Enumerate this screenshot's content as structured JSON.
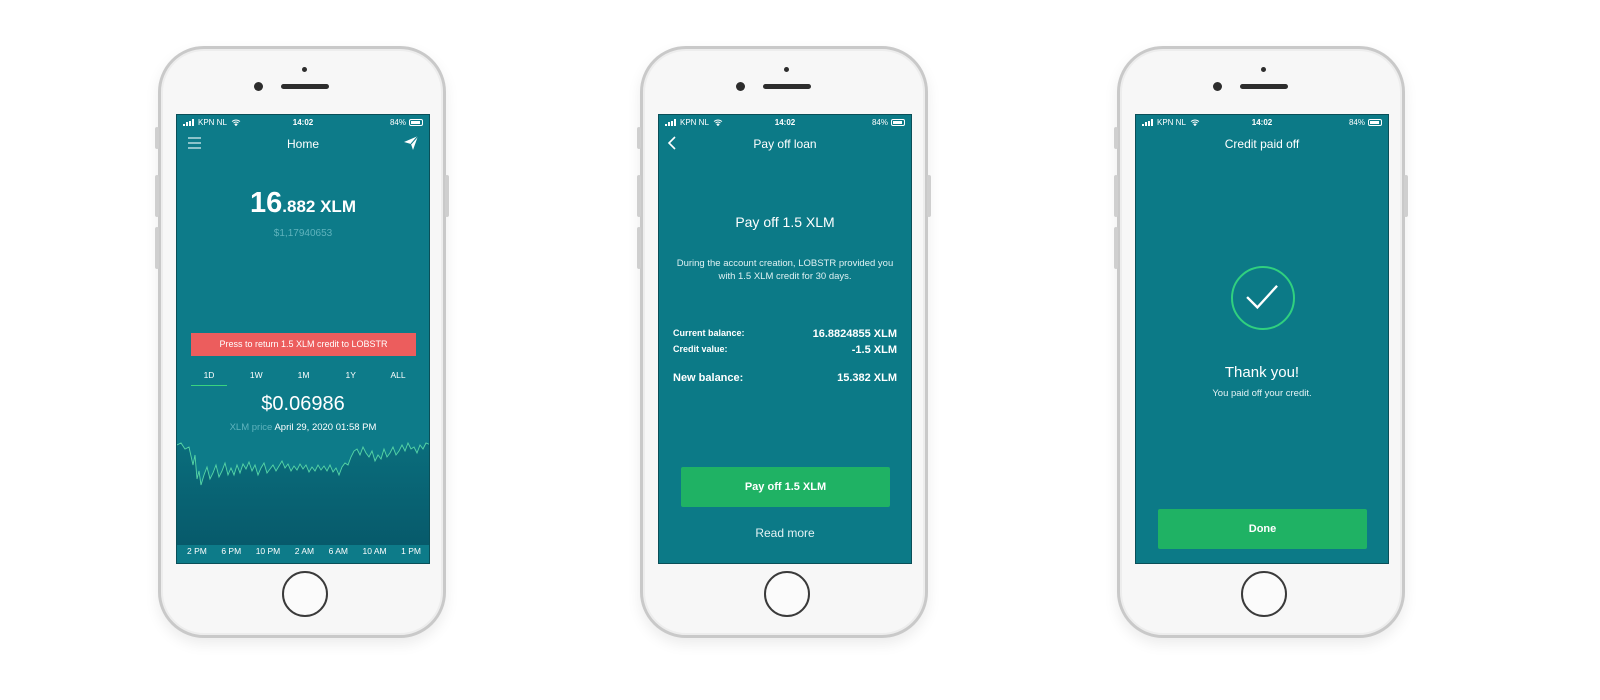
{
  "status": {
    "carrier": "KPN NL",
    "time": "14:02",
    "battery": "84%"
  },
  "screen1": {
    "title": "Home",
    "balance_int": "16",
    "balance_frac": ".882 XLM",
    "balance_usd": "$1,17940653",
    "banner": "Press to return 1.5 XLM credit to LOBSTR",
    "ranges": [
      "1D",
      "1W",
      "1M",
      "1Y",
      "ALL"
    ],
    "active_range": "1D",
    "price": "$0.06986",
    "price_label": "XLM price",
    "price_date": "April 29, 2020 01:58 PM",
    "chart_times": [
      "2 PM",
      "6 PM",
      "10 PM",
      "2 AM",
      "6 AM",
      "10 AM",
      "1 PM"
    ]
  },
  "screen2": {
    "title": "Pay off loan",
    "heading": "Pay off 1.5 XLM",
    "description": "During the account creation, LOBSTR provided you with 1.5 XLM credit for 30 days.",
    "current_balance_label": "Current balance:",
    "current_balance_value": "16.8824855 XLM",
    "credit_value_label": "Credit value:",
    "credit_value": "-1.5 XLM",
    "new_balance_label": "New balance:",
    "new_balance_value": "15.382 XLM",
    "pay_button": "Pay off 1.5 XLM",
    "read_more": "Read more"
  },
  "screen3": {
    "title": "Credit paid off",
    "thanks": "Thank you!",
    "message": "You paid off your credit.",
    "done_button": "Done"
  },
  "colors": {
    "screen_bg": "#0c7a87",
    "accent_green": "#1fb264",
    "banner_red": "#ec5d5d",
    "chart_line": "#57d6a6"
  },
  "icons": [
    "menu-icon",
    "send-icon",
    "back-icon",
    "check-icon",
    "wifi-icon",
    "signal-icon",
    "battery-icon"
  ]
}
